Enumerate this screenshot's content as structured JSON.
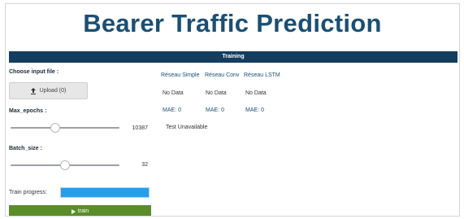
{
  "page": {
    "title": "Bearer Traffic Prediction"
  },
  "training": {
    "section_title": "Training",
    "input_file": {
      "label": "Choose input file :",
      "upload_label": "Upload (0)"
    },
    "max_epochs": {
      "label": "Max_epochs :",
      "value": "10387",
      "level": 0.4
    },
    "batch_size": {
      "label": "Batch_size :",
      "value": "32",
      "level": 0.5
    },
    "progress": {
      "label": "Train progress:",
      "value": 1.0
    },
    "train_button_label": "train",
    "colors": {
      "title": "#1b4f73",
      "section_bar": "#143d5e",
      "train_button": "#5a8d2a",
      "progress_fill": "#2a9de8"
    }
  },
  "models": [
    {
      "name": "Réseau Simple",
      "status": "No Data",
      "mae_label": "MAE:",
      "mae_value": "0"
    },
    {
      "name": "Réseau Conv",
      "status": "No Data",
      "mae_label": "MAE:",
      "mae_value": "0"
    },
    {
      "name": "Réseau LSTM",
      "status": "No Data",
      "mae_label": "MAE:",
      "mae_value": "0"
    }
  ],
  "test_status": "Test Unavailable"
}
